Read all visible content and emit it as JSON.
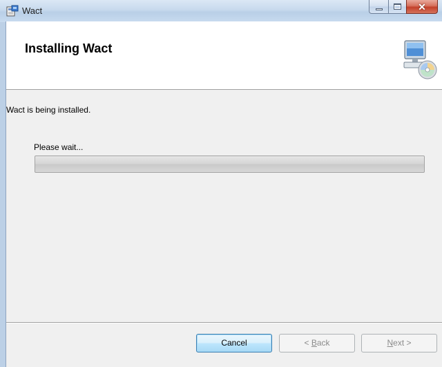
{
  "window": {
    "title": "Wact",
    "icons": {
      "app": "installer-icon",
      "header": "computer-cd-icon"
    }
  },
  "header": {
    "title": "Installing Wact"
  },
  "body": {
    "status": "Wact is being installed.",
    "wait": "Please wait...",
    "progress_fraction": 0
  },
  "buttons": {
    "cancel": "Cancel",
    "back_prefix": "< ",
    "back_accel": "B",
    "back_rest": "ack",
    "next_accel": "N",
    "next_rest": "ext >"
  }
}
